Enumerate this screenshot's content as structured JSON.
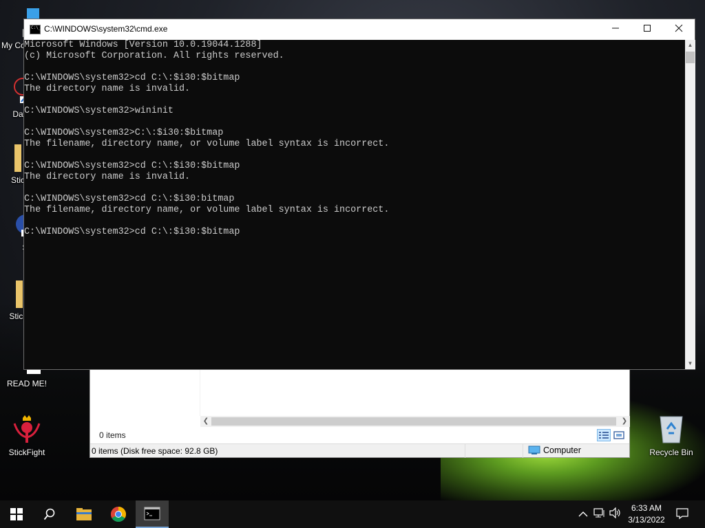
{
  "desktop": {
    "icons": [
      {
        "label": "My Co",
        "icon": "computer-icon"
      },
      {
        "label": "DataV",
        "icon": "app-shortcut-icon"
      },
      {
        "label": "Stick",
        "icon": "folder-icon"
      },
      {
        "label": "St",
        "icon": "app-shortcut-icon"
      },
      {
        "label": "StickF",
        "icon": "folder-icon"
      },
      {
        "label": "READ ME!",
        "icon": "text-document-icon"
      },
      {
        "label": "StickFight",
        "icon": "stickfight-game-icon"
      },
      {
        "label": "Recycle Bin",
        "icon": "recycle-bin-icon"
      }
    ]
  },
  "cmd": {
    "title": "C:\\WINDOWS\\system32\\cmd.exe",
    "lines": [
      "Microsoft Windows [Version 10.0.19044.1288]",
      "(c) Microsoft Corporation. All rights reserved.",
      "",
      "C:\\WINDOWS\\system32>cd C:\\:$i30:$bitmap",
      "The directory name is invalid.",
      "",
      "C:\\WINDOWS\\system32>wininit",
      "",
      "C:\\WINDOWS\\system32>C:\\:$i30:$bitmap",
      "The filename, directory name, or volume label syntax is incorrect.",
      "",
      "C:\\WINDOWS\\system32>cd C:\\:$i30:$bitmap",
      "The directory name is invalid.",
      "",
      "C:\\WINDOWS\\system32>cd C:\\:$i30:bitmap",
      "The filename, directory name, or volume label syntax is incorrect.",
      "",
      "C:\\WINDOWS\\system32>cd C:\\:$i30:$bitmap"
    ]
  },
  "explorer": {
    "items_count": "0 items",
    "status_left": "0 items (Disk free space: 92.8 GB)",
    "status_location": "Computer"
  },
  "taskbar": {
    "pinned": [
      {
        "name": "start-button",
        "icon": "windows-logo-icon"
      },
      {
        "name": "search-button",
        "icon": "search-icon"
      },
      {
        "name": "file-explorer-button",
        "icon": "folder-icon"
      },
      {
        "name": "chrome-button",
        "icon": "chrome-icon"
      },
      {
        "name": "cmd-taskbar-button",
        "icon": "command-prompt-icon",
        "active": true
      }
    ],
    "clock_time": "6:33 AM",
    "clock_date": "3/13/2022"
  },
  "colors": {
    "console_bg": "#0c0c0c",
    "console_fg": "#cccccc",
    "taskbar_bg": "#101010"
  }
}
